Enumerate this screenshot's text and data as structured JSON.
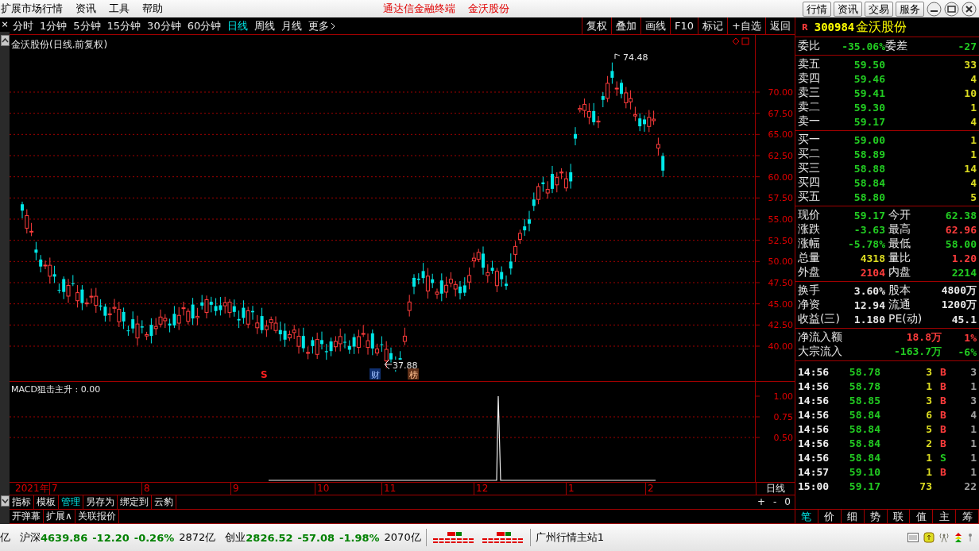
{
  "menu": [
    "扩展市场行情",
    "资讯",
    "工具",
    "帮助"
  ],
  "app_title": "通达信金融终端",
  "stock_title": "金沃股份",
  "top_buttons": [
    "行情",
    "资讯",
    "交易",
    "服务"
  ],
  "close_mark": "×",
  "periods": [
    {
      "label": "分时",
      "selected": false
    },
    {
      "label": "1分钟",
      "selected": false
    },
    {
      "label": "5分钟",
      "selected": false
    },
    {
      "label": "15分钟",
      "selected": false
    },
    {
      "label": "30分钟",
      "selected": false
    },
    {
      "label": "60分钟",
      "selected": false
    },
    {
      "label": "日线",
      "selected": true
    },
    {
      "label": "周线",
      "selected": false
    },
    {
      "label": "月线",
      "selected": false
    }
  ],
  "more": "更多",
  "chart_tools": [
    "复权",
    "叠加",
    "画线",
    "F10",
    "标记",
    "+自选",
    "返回"
  ],
  "chart_title": "金沃股份(日线.前复权)",
  "price_axis": [
    "70.00",
    "67.50",
    "65.00",
    "62.50",
    "60.00",
    "57.50",
    "55.00",
    "52.50",
    "50.00",
    "47.50",
    "45.00",
    "42.50",
    "40.00"
  ],
  "high_label": "74.48",
  "low_label": "37.88",
  "markers": [
    {
      "text": "S",
      "kind": "signal"
    },
    {
      "text": "财",
      "kind": "finance"
    },
    {
      "text": "榜",
      "kind": "rank"
    }
  ],
  "indicator": {
    "title": "MACD狙击主升 : 0.00",
    "axis": [
      "1.00",
      "0.75",
      "0.50"
    ]
  },
  "date_axis": [
    "2021年",
    "7",
    "8",
    "9",
    "10",
    "11",
    "12",
    "1",
    "2"
  ],
  "period_label": "日线",
  "tool_tabs": [
    {
      "label": "指标",
      "selected": false
    },
    {
      "label": "模板",
      "selected": false
    },
    {
      "label": "管理",
      "selected": true
    },
    {
      "label": "另存为",
      "selected": false
    },
    {
      "label": "绑定到",
      "selected": false
    },
    {
      "label": "云豹",
      "selected": false
    }
  ],
  "zoom_controls": [
    "+",
    "-",
    "0"
  ],
  "extra_tabs": [
    "开弹幕",
    "扩展∧",
    "关联报价"
  ],
  "quote": {
    "flag": "R",
    "code": "300984",
    "name": "金沃股份",
    "commission": {
      "label": "委比",
      "value": {
        "text": "-35.06%",
        "color": "#22cc22"
      },
      "label2": "委差",
      "value2": {
        "text": "-27",
        "color": "#22cc22"
      }
    },
    "asks": [
      {
        "label": "卖五",
        "price": "59.50",
        "volume": "33"
      },
      {
        "label": "卖四",
        "price": "59.46",
        "volume": "4"
      },
      {
        "label": "卖三",
        "price": "59.41",
        "volume": "10"
      },
      {
        "label": "卖二",
        "price": "59.30",
        "volume": "1"
      },
      {
        "label": "卖一",
        "price": "59.17",
        "volume": "4"
      }
    ],
    "bids": [
      {
        "label": "买一",
        "price": "59.00",
        "volume": "1"
      },
      {
        "label": "买二",
        "price": "58.89",
        "volume": "1"
      },
      {
        "label": "买三",
        "price": "58.88",
        "volume": "14"
      },
      {
        "label": "买四",
        "price": "58.84",
        "volume": "4"
      },
      {
        "label": "买五",
        "price": "58.80",
        "volume": "5"
      }
    ],
    "stats": [
      {
        "label": "现价",
        "value": {
          "text": "59.17",
          "color": "#22cc22"
        },
        "label2": "今开",
        "value2": {
          "text": "62.38",
          "color": "#22cc22"
        }
      },
      {
        "label": "涨跌",
        "value": {
          "text": "-3.63",
          "color": "#22cc22"
        },
        "label2": "最高",
        "value2": {
          "text": "62.96",
          "color": "#ff3c3c"
        }
      },
      {
        "label": "涨幅",
        "value": {
          "text": "-5.78%",
          "color": "#22cc22"
        },
        "label2": "最低",
        "value2": {
          "text": "58.00",
          "color": "#22cc22"
        }
      },
      {
        "label": "总量",
        "value": {
          "text": "4318",
          "color": "#dddd22"
        },
        "label2": "量比",
        "value2": {
          "text": "1.20",
          "color": "#ff3c3c"
        }
      },
      {
        "label": "外盘",
        "value": {
          "text": "2104",
          "color": "#ff3c3c"
        },
        "label2": "内盘",
        "value2": {
          "text": "2214",
          "color": "#22cc22"
        }
      }
    ],
    "fundamentals": [
      {
        "label": "换手",
        "value": {
          "text": "3.60%",
          "color": "#e8e8e8"
        },
        "label2": "股本",
        "value2": {
          "text": "4800万",
          "color": "#e8e8e8"
        }
      },
      {
        "label": "净资",
        "value": {
          "text": "12.94",
          "color": "#e8e8e8"
        },
        "label2": "流通",
        "value2": {
          "text": "1200万",
          "color": "#e8e8e8"
        }
      },
      {
        "label": "收益(三)",
        "value": {
          "text": "1.180",
          "color": "#e8e8e8"
        },
        "label2": "PE(动)",
        "value2": {
          "text": "45.1",
          "color": "#e8e8e8"
        }
      }
    ],
    "flows": [
      {
        "label": "净流入额",
        "value": {
          "text": "18.8万",
          "color": "#ff3c3c"
        },
        "share": {
          "text": "1%",
          "color": "#ff3c3c"
        }
      },
      {
        "label": "大宗流入",
        "value": {
          "text": "-163.7万",
          "color": "#22cc22"
        },
        "share": {
          "text": "-6%",
          "color": "#22cc22"
        }
      }
    ],
    "trades": [
      {
        "time": "14:56",
        "price": "58.78",
        "volume": "3",
        "side": "B",
        "kind": "buy",
        "count": "3"
      },
      {
        "time": "14:56",
        "price": "58.78",
        "volume": "1",
        "side": "B",
        "kind": "buy",
        "count": "1"
      },
      {
        "time": "14:56",
        "price": "58.85",
        "volume": "3",
        "side": "B",
        "kind": "buy",
        "count": "3"
      },
      {
        "time": "14:56",
        "price": "58.84",
        "volume": "6",
        "side": "B",
        "kind": "buy",
        "count": "4"
      },
      {
        "time": "14:56",
        "price": "58.84",
        "volume": "5",
        "side": "B",
        "kind": "buy",
        "count": "1"
      },
      {
        "time": "14:56",
        "price": "58.84",
        "volume": "2",
        "side": "B",
        "kind": "buy",
        "count": "1"
      },
      {
        "time": "14:56",
        "price": "58.84",
        "volume": "1",
        "side": "S",
        "kind": "sell",
        "count": "1"
      },
      {
        "time": "14:57",
        "price": "59.10",
        "volume": "1",
        "side": "B",
        "kind": "buy",
        "count": "1"
      },
      {
        "time": "15:00",
        "price": "59.17",
        "volume": "73",
        "kind": "close",
        "count": "22"
      }
    ],
    "tabs": [
      {
        "label": "笔",
        "selected": true
      },
      {
        "label": "价",
        "selected": false
      },
      {
        "label": "细",
        "selected": false
      },
      {
        "label": "势",
        "selected": false
      },
      {
        "label": "联",
        "selected": false
      },
      {
        "label": "值",
        "selected": false
      },
      {
        "label": "主",
        "selected": false
      },
      {
        "label": "筹",
        "selected": false
      }
    ]
  },
  "status_bar": {
    "lead": "亿",
    "indices": [
      {
        "name": "沪深",
        "value": "4639.86",
        "change": "-12.20",
        "percent": "-0.26%",
        "amount": "2872亿"
      },
      {
        "name": "创业",
        "value": "2826.52",
        "change": "-57.08",
        "percent": "-1.98%",
        "amount": "2070亿"
      }
    ],
    "server": "广州行情主站1"
  }
}
